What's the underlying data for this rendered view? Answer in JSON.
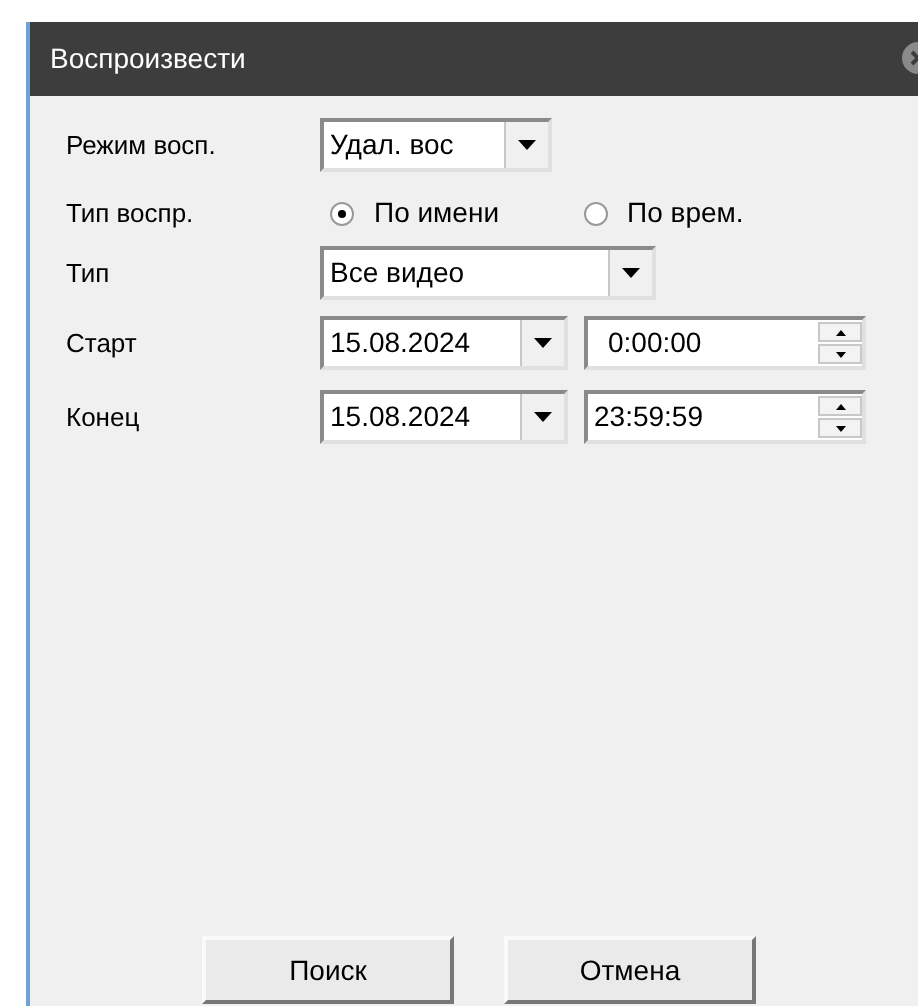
{
  "window": {
    "title": "Воспроизвести"
  },
  "fields": [
    {
      "kind": "select",
      "label": "Режим восп.",
      "value": "Удал. вос",
      "wide": false
    },
    {
      "kind": "radio",
      "label": "Тип воспр.",
      "options": [
        {
          "label": "По имени",
          "selected": true
        },
        {
          "label": "По врем.",
          "selected": false
        }
      ]
    },
    {
      "kind": "select",
      "label": "Тип",
      "value": "Все видео",
      "wide": true
    },
    {
      "kind": "datetime",
      "label": "Старт",
      "date": "15.08.2024",
      "time": "0:00:00"
    },
    {
      "kind": "datetime",
      "label": "Конец",
      "date": "15.08.2024",
      "time": "23:59:59"
    }
  ],
  "buttons": [
    "Поиск",
    "Отмена"
  ]
}
